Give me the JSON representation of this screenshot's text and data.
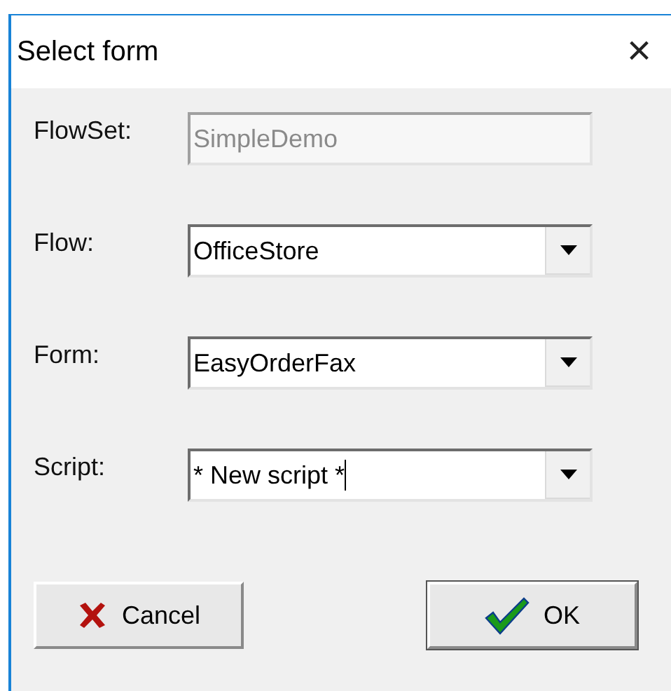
{
  "window": {
    "title": "Select form",
    "close": "×"
  },
  "fields": [
    {
      "kind": "text",
      "label": "FlowSet:",
      "value": "SimpleDemo",
      "disabled": true,
      "focused": false
    },
    {
      "kind": "dropdown",
      "label": "Flow:",
      "value": "OfficeStore",
      "disabled": false,
      "focused": false
    },
    {
      "kind": "dropdown",
      "label": "Form:",
      "value": "EasyOrderFax",
      "disabled": false,
      "focused": false
    },
    {
      "kind": "dropdown",
      "label": "Script:",
      "value": "* New script *",
      "disabled": false,
      "focused": true
    }
  ],
  "buttons": [
    {
      "kind": "cancel",
      "label": "Cancel"
    },
    {
      "kind": "ok",
      "label": "OK"
    }
  ]
}
